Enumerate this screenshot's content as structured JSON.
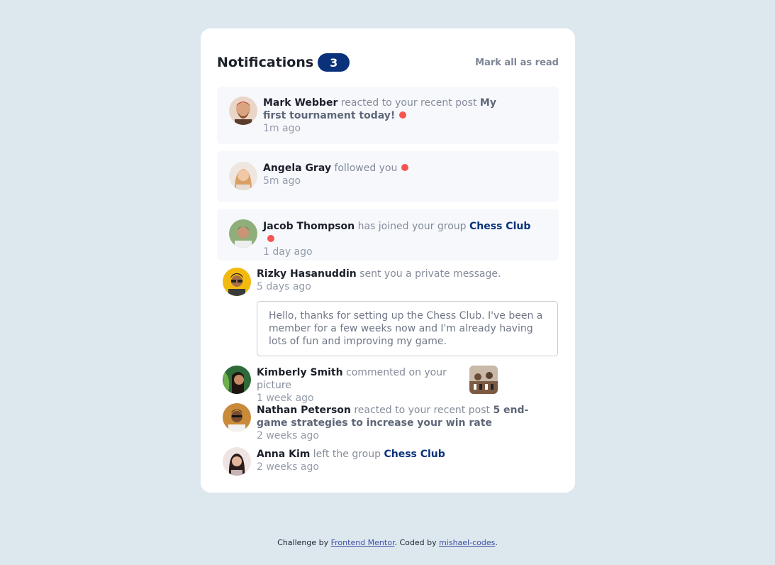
{
  "header": {
    "title": "Notifications",
    "unread_count": "3",
    "mark_all_label": "Mark all as read"
  },
  "notifications": [
    {
      "actor": "Mark Webber",
      "action": "reacted to your recent post",
      "target": "My first tournament today!",
      "time": "1m ago",
      "unread": true
    },
    {
      "actor": "Angela Gray",
      "action": "followed you",
      "time": "5m ago",
      "unread": true
    },
    {
      "actor": "Jacob Thompson",
      "action": "has joined your group",
      "target": "Chess Club",
      "time": "1 day ago",
      "unread": true
    },
    {
      "actor": "Rizky Hasanuddin",
      "action": "sent you a private message.",
      "time": "5 days ago",
      "unread": false,
      "message": "Hello, thanks for setting up the Chess Club. I've been a member for a few weeks now and I'm already having lots of fun and improving my game."
    },
    {
      "actor": "Kimberly Smith",
      "action": "commented on your picture",
      "time": "1 week ago",
      "unread": false
    },
    {
      "actor": "Nathan Peterson",
      "action": "reacted to your recent post",
      "target": "5 end-game strategies to increase your win rate",
      "time": "2 weeks ago",
      "unread": false
    },
    {
      "actor": "Anna Kim",
      "action": "left the group",
      "target": "Chess Club",
      "time": "2 weeks ago",
      "unread": false
    }
  ],
  "footer": {
    "prefix": "Challenge by",
    "link1": "Frontend Mentor",
    "middle": ". Coded by",
    "link2": "mishael-codes",
    "suffix": "."
  },
  "colors": {
    "background": "#dde7ee",
    "badge": "#0a327b",
    "unread_dot": "#f65552",
    "unread_bg": "#f6f8fc"
  }
}
